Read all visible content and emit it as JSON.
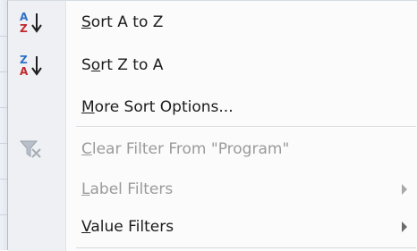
{
  "menu": {
    "items": [
      {
        "label_pre": "",
        "mnemonic": "S",
        "label_post": "ort A to Z",
        "icon": "sort-az-icon",
        "disabled": false
      },
      {
        "label_pre": "S",
        "mnemonic": "o",
        "label_post": "rt Z to A",
        "icon": "sort-za-icon",
        "disabled": false
      },
      {
        "label_pre": "",
        "mnemonic": "M",
        "label_post": "ore Sort Options...",
        "icon": "",
        "disabled": false
      },
      {
        "label_pre": "",
        "mnemonic": "C",
        "label_post": "lear Filter From \"Program\"",
        "icon": "clear-filter-icon",
        "disabled": true
      },
      {
        "label_pre": "",
        "mnemonic": "L",
        "label_post": "abel Filters",
        "icon": "",
        "disabled": true,
        "submenu": true
      },
      {
        "label_pre": "",
        "mnemonic": "V",
        "label_post": "alue Filters",
        "icon": "",
        "disabled": false,
        "submenu": true
      }
    ]
  },
  "icons": {
    "sort_az": {
      "top": "A",
      "bottom": "Z"
    },
    "sort_za": {
      "top": "Z",
      "bottom": "A"
    }
  },
  "colors": {
    "az_letter_top": "#2f6fc7",
    "az_letter_bottom": "#c0282d",
    "arrow": "#1e1e1e"
  }
}
